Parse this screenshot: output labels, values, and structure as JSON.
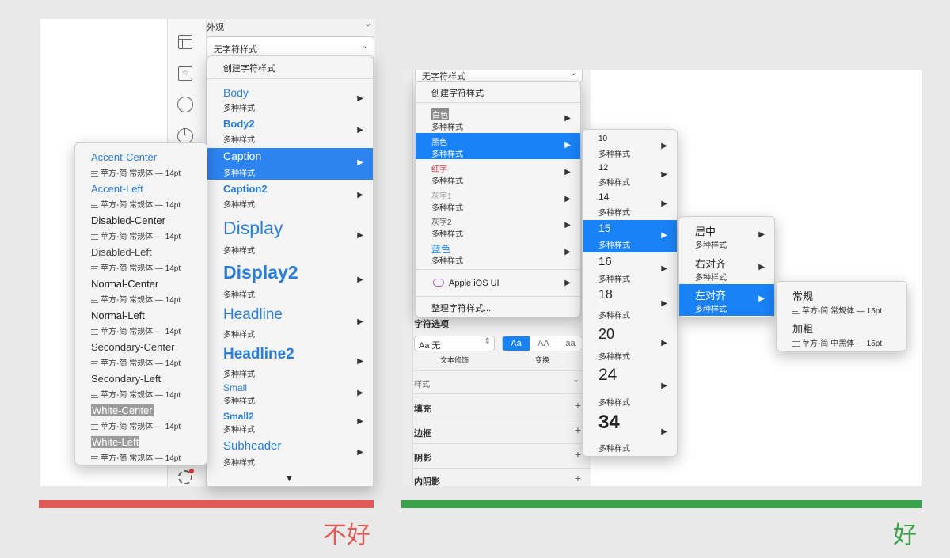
{
  "bad": {
    "inspector": {
      "section_title": "外观",
      "style_select_value": "无字符样式"
    },
    "menu": {
      "create_label": "创建字符样式",
      "items": [
        {
          "name": "Body",
          "sub": "多种样式"
        },
        {
          "name": "Body2",
          "sub": "多种样式"
        },
        {
          "name": "Caption",
          "sub": "多种样式"
        },
        {
          "name": "Caption2",
          "sub": "多种样式"
        },
        {
          "name": "Display",
          "sub": "多种样式"
        },
        {
          "name": "Display2",
          "sub": "多种样式"
        },
        {
          "name": "Headline",
          "sub": "多种样式"
        },
        {
          "name": "Headline2",
          "sub": "多种样式"
        },
        {
          "name": "Small",
          "sub": "多种样式"
        },
        {
          "name": "Small2",
          "sub": "多种样式"
        },
        {
          "name": "Subheader",
          "sub": "多种样式"
        }
      ],
      "scroll_down": "▼"
    },
    "submenu": {
      "items": [
        {
          "name": "Accent-Center",
          "meta": "苹方-简 常规体 — 14pt"
        },
        {
          "name": "Accent-Left",
          "meta": "苹方-简 常规体 — 14pt"
        },
        {
          "name": "Disabled-Center",
          "meta": "苹方-简 常规体 — 14pt"
        },
        {
          "name": "Disabled-Left",
          "meta": "苹方-简 常规体 — 14pt"
        },
        {
          "name": "Normal-Center",
          "meta": "苹方-简 常规体 — 14pt"
        },
        {
          "name": "Normal-Left",
          "meta": "苹方-简 常规体 — 14pt"
        },
        {
          "name": "Secondary-Center",
          "meta": "苹方-简 常规体 — 14pt"
        },
        {
          "name": "Secondary-Left",
          "meta": "苹方-简 常规体 — 14pt"
        },
        {
          "name": "White-Center",
          "meta": "苹方-简 常规体 — 14pt"
        },
        {
          "name": "White-Left",
          "meta": "苹方-简 常规体 — 14pt"
        }
      ]
    },
    "verdict_label": "不好",
    "verdict_color": "#e05a55"
  },
  "good": {
    "inspector": {
      "style_select_value": "无字符样式",
      "char_options_title": "字符选项",
      "text_decoration_value": "Aa 无",
      "text_decoration_label": "文本修饰",
      "transform_options": [
        "Aa",
        "AA",
        "aa"
      ],
      "transform_label": "变换",
      "style_section": "样式",
      "fill": "填充",
      "border": "边框",
      "shadow": "阴影",
      "inner_shadow": "内阴影"
    },
    "menu": {
      "create_label": "创建字符样式",
      "items": [
        {
          "name": "白色",
          "sub": "多种样式"
        },
        {
          "name": "黑色",
          "sub": "多种样式"
        },
        {
          "name": "红字",
          "sub": "多种样式"
        },
        {
          "name": "灰字1",
          "sub": "多种样式"
        },
        {
          "name": "灰字2",
          "sub": "多种样式"
        },
        {
          "name": "蓝色",
          "sub": "多种样式"
        }
      ],
      "library": "Apple iOS UI",
      "organize": "整理字符样式..."
    },
    "sizes": [
      {
        "name": "10",
        "sub": "多种样式"
      },
      {
        "name": "12",
        "sub": "多种样式"
      },
      {
        "name": "14",
        "sub": "多种样式"
      },
      {
        "name": "15",
        "sub": "多种样式"
      },
      {
        "name": "16",
        "sub": "多种样式"
      },
      {
        "name": "18",
        "sub": "多种样式"
      },
      {
        "name": "20",
        "sub": "多种样式"
      },
      {
        "name": "24",
        "sub": "多种样式"
      },
      {
        "name": "34",
        "sub": "多种样式"
      }
    ],
    "align": [
      {
        "name": "居中",
        "sub": "多种样式"
      },
      {
        "name": "右对齐",
        "sub": "多种样式"
      },
      {
        "name": "左对齐",
        "sub": "多种样式"
      }
    ],
    "weight": [
      {
        "name": "常规",
        "meta": "苹方-简 常规体 — 15pt"
      },
      {
        "name": "加粗",
        "meta": "苹方-简 中黑体 — 15pt"
      }
    ],
    "verdict_label": "好",
    "verdict_color": "#3aa24a"
  },
  "icons": {
    "arrow": "▶",
    "chevron": "⌄"
  }
}
